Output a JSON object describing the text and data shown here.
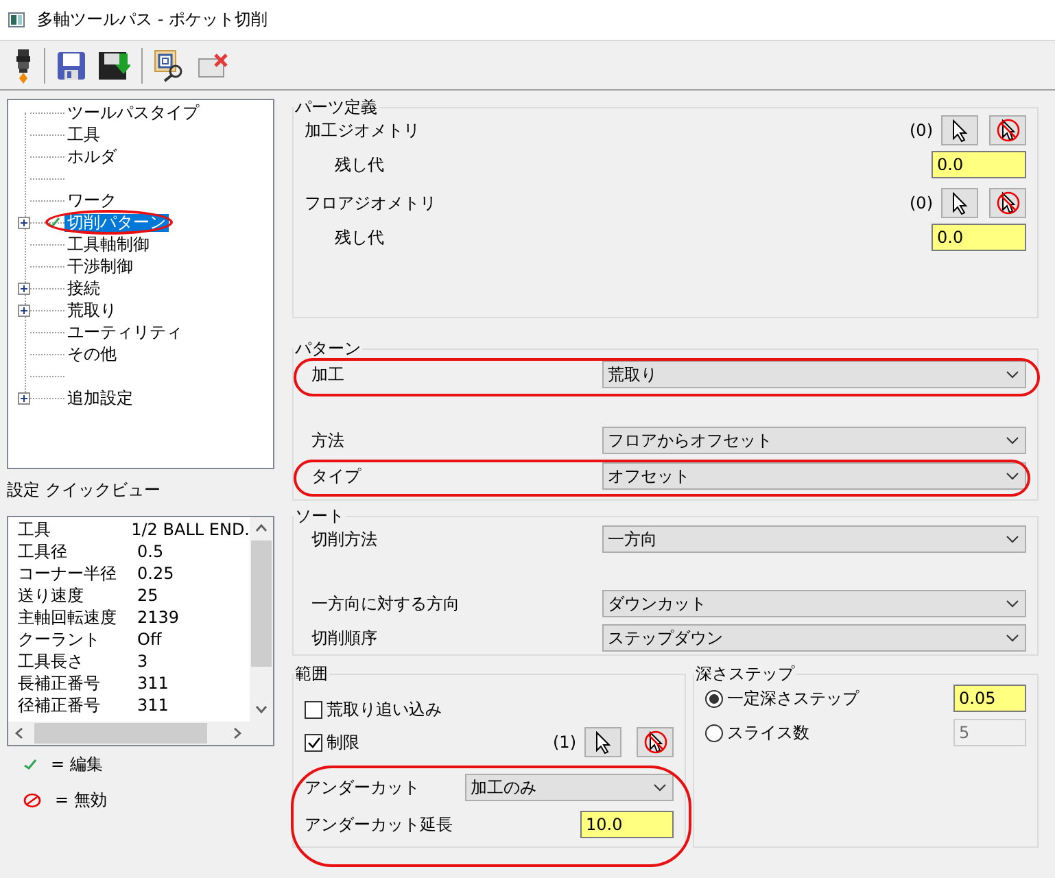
{
  "window": {
    "title": "多軸ツールパス - ポケット切削"
  },
  "tree": {
    "items": [
      {
        "kind": "item",
        "label": "ツールパスタイプ",
        "expandable": false,
        "edited": false,
        "selected": false
      },
      {
        "kind": "item",
        "label": "工具",
        "expandable": false,
        "edited": false,
        "selected": false
      },
      {
        "kind": "item",
        "label": "ホルダ",
        "expandable": false,
        "edited": false,
        "selected": false
      },
      {
        "kind": "spacer"
      },
      {
        "kind": "item",
        "label": "ワーク",
        "expandable": false,
        "edited": false,
        "selected": false
      },
      {
        "kind": "item",
        "label": "切削パターン",
        "expandable": true,
        "edited": true,
        "selected": true
      },
      {
        "kind": "item",
        "label": "工具軸制御",
        "expandable": false,
        "edited": false,
        "selected": false
      },
      {
        "kind": "item",
        "label": "干渉制御",
        "expandable": false,
        "edited": false,
        "selected": false
      },
      {
        "kind": "item",
        "label": "接続",
        "expandable": true,
        "edited": false,
        "selected": false
      },
      {
        "kind": "item",
        "label": "荒取り",
        "expandable": true,
        "edited": false,
        "selected": false
      },
      {
        "kind": "item",
        "label": "ユーティリティ",
        "expandable": false,
        "edited": false,
        "selected": false
      },
      {
        "kind": "item",
        "label": "その他",
        "expandable": false,
        "edited": false,
        "selected": false
      },
      {
        "kind": "spacer"
      },
      {
        "kind": "item",
        "label": "追加設定",
        "expandable": true,
        "edited": false,
        "selected": false
      }
    ]
  },
  "quick_view": {
    "title": "設定 クイックビュー",
    "rows": [
      {
        "name": "工具",
        "value": "1/2 BALL END."
      },
      {
        "name": "工具径",
        "value": "0.5"
      },
      {
        "name": "コーナー半径",
        "value": "0.25"
      },
      {
        "name": "送り速度",
        "value": "25"
      },
      {
        "name": "主軸回転速度",
        "value": "2139"
      },
      {
        "name": "クーラント",
        "value": "Off"
      },
      {
        "name": "工具長さ",
        "value": "3"
      },
      {
        "name": "長補正番号",
        "value": "311"
      },
      {
        "name": "径補正番号",
        "value": "311"
      }
    ]
  },
  "legend": [
    {
      "kind": "edited",
      "text": "= 編集"
    },
    {
      "kind": "disabled",
      "text": "= 無効"
    }
  ],
  "part_definition": {
    "title": "パーツ定義",
    "geometries": [
      {
        "label": "加工ジオメトリ",
        "count": "(0)",
        "stock_label": "残し代",
        "stock": "0.0"
      },
      {
        "label": "フロアジオメトリ",
        "count": "(0)",
        "stock_label": "残し代",
        "stock": "0.0"
      }
    ]
  },
  "pattern": {
    "title": "パターン",
    "machining": {
      "label": "加工",
      "value": "荒取り"
    },
    "method": {
      "label": "方法",
      "value": "フロアからオフセット"
    },
    "type": {
      "label": "タイプ",
      "value": "オフセット"
    }
  },
  "sort": {
    "title": "ソート",
    "cut_method": {
      "label": "切削方法",
      "value": "一方向"
    },
    "direction": {
      "label": "一方向に対する方向",
      "value": "ダウンカット"
    },
    "order": {
      "label": "切削順序",
      "value": "ステップダウン"
    }
  },
  "range": {
    "title": "範囲",
    "rough_rest": {
      "label": "荒取り追い込み",
      "checked": false
    },
    "limit": {
      "label": "制限",
      "checked": true,
      "count": "(1)"
    },
    "undercut": {
      "label": "アンダーカット",
      "value": "加工のみ"
    },
    "undercut_extension": {
      "label": "アンダーカット延長",
      "value": "10.0"
    }
  },
  "depth_step": {
    "title": "深さステップ",
    "options": [
      {
        "label": "一定深さステップ",
        "selected": true,
        "value": "0.05",
        "disabled": false
      },
      {
        "label": "スライス数",
        "selected": false,
        "value": "5",
        "disabled": true
      }
    ]
  }
}
